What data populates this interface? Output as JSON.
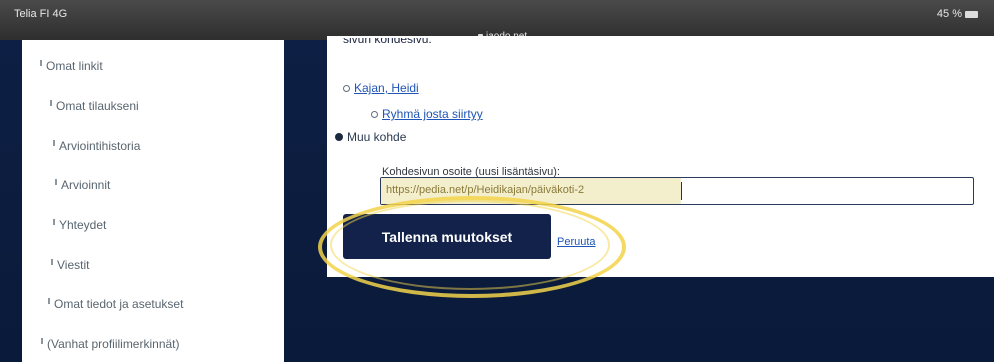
{
  "statusbar": {
    "carrier": "Telia FI 4G",
    "url": "jaodo.net",
    "battery": "45 %"
  },
  "sidebar": {
    "items": [
      {
        "label": "Omat linkit"
      },
      {
        "label": "Omat tilaukseni"
      },
      {
        "label": "Arviointihistoria"
      },
      {
        "label": "Arvioinnit"
      },
      {
        "label": "Yhteydet"
      },
      {
        "label": "Viestit"
      },
      {
        "label": "Omat tiedot ja asetukset"
      },
      {
        "label": "(Vanhat profiilimerkinnät)"
      }
    ]
  },
  "form": {
    "cutoff_text": "sivun kohdesivu:",
    "options": [
      {
        "label": "Kajan, Heidi",
        "link": true,
        "checked": false
      },
      {
        "label": "Ryhmä josta siirtyy",
        "link": true,
        "checked": false
      },
      {
        "label": "Muu kohde",
        "link": false,
        "checked": true
      }
    ],
    "url_label": "Kohdesivun osoite (uusi lisäntäsivu):",
    "url_value": "https://pedia.net/p/Heidikajan/päiväkoti-2",
    "save_label": "Tallenna muutokset",
    "cancel_label": "Peruuta"
  },
  "colors": {
    "navy": "#13224a",
    "highlight": "#f2d34a",
    "link": "#1f55b6"
  }
}
